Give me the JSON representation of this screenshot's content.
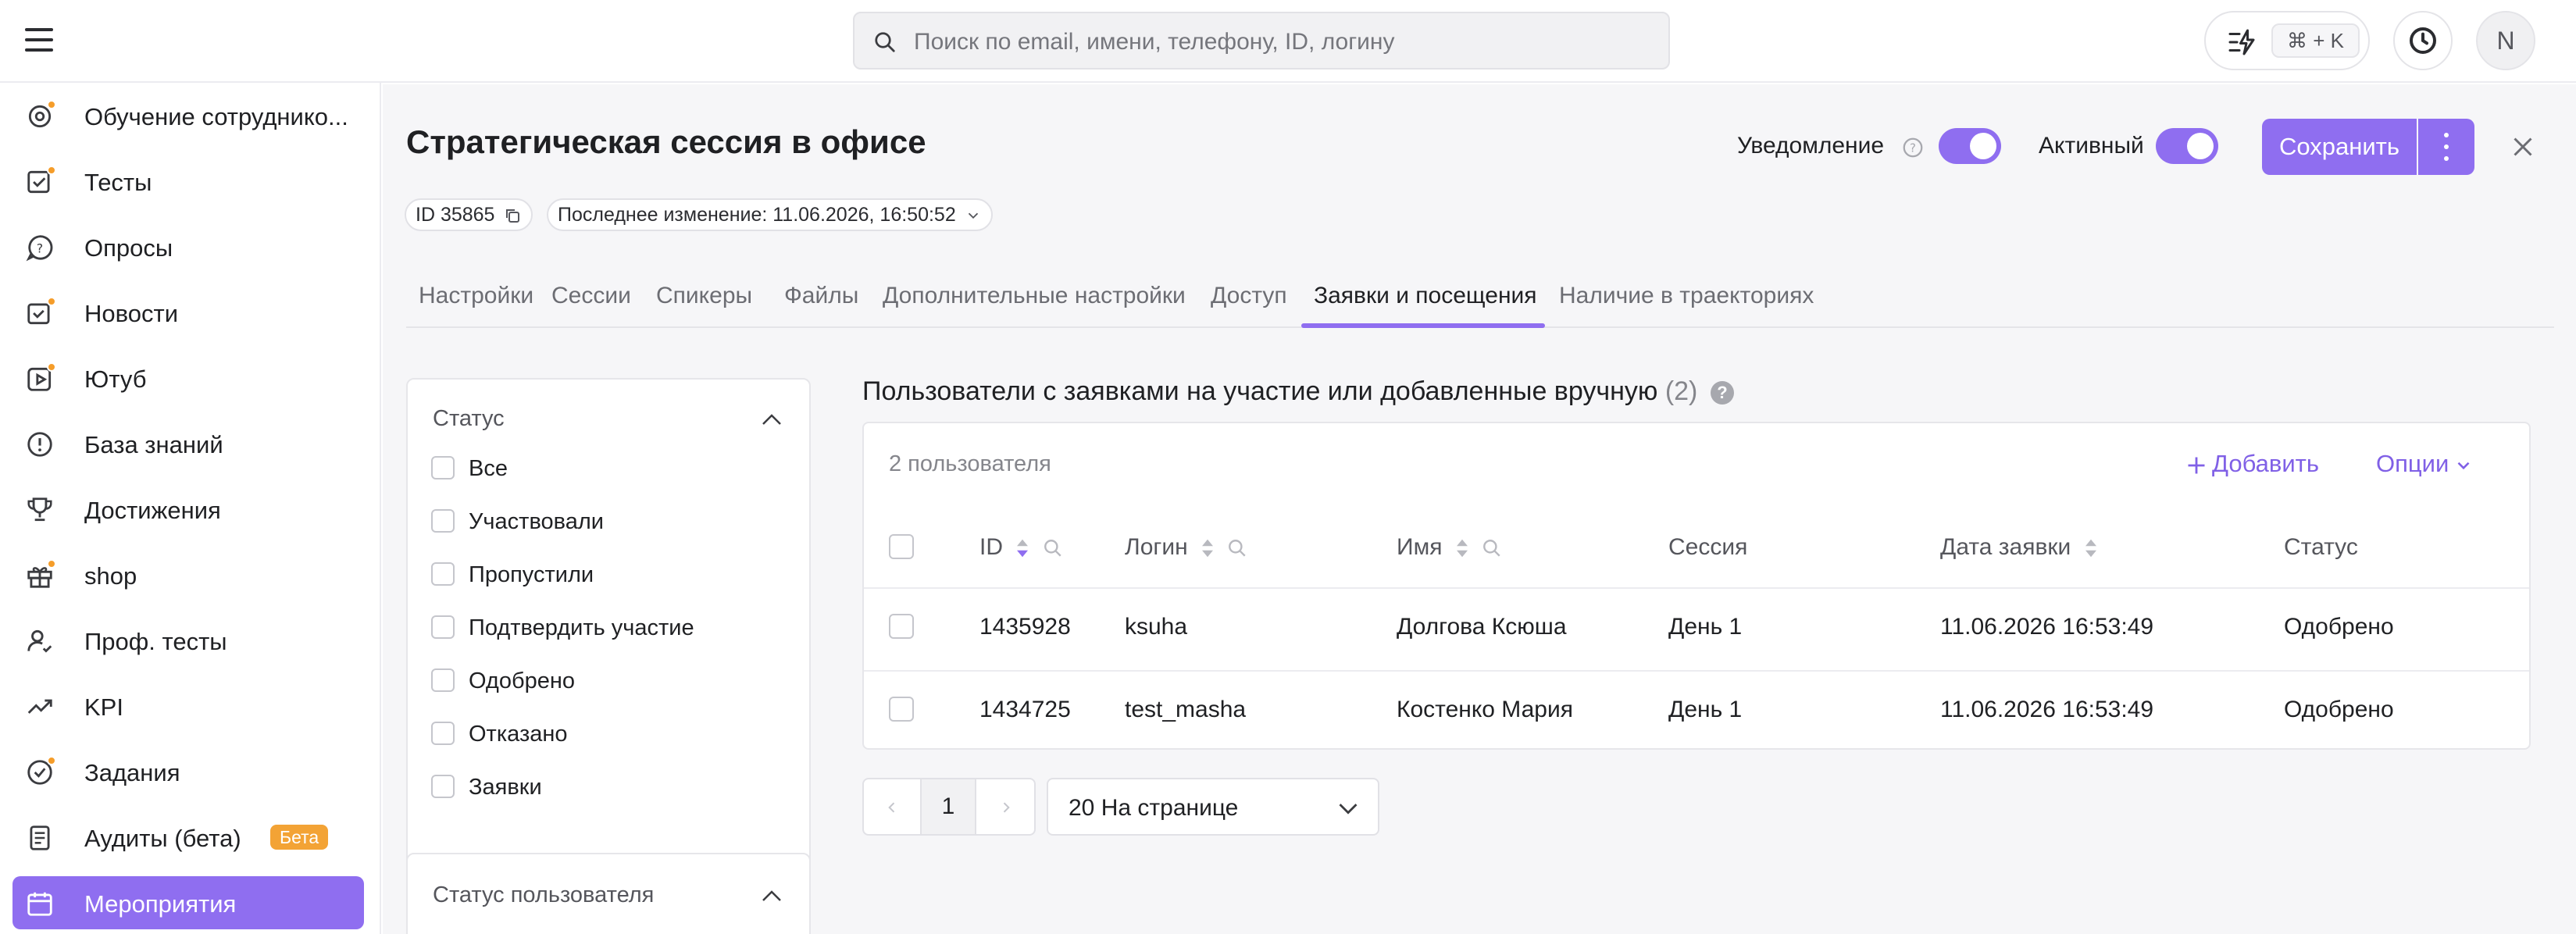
{
  "search": {
    "placeholder": "Поиск по email, имени, телефону, ID, логину"
  },
  "topbar": {
    "shortcut": "⌘ + K",
    "avatar_initial": "N"
  },
  "sidebar": {
    "items": [
      {
        "label": "Обучение сотруднико...",
        "icon": "graduation-icon"
      },
      {
        "label": "Тесты",
        "icon": "checklist-icon"
      },
      {
        "label": "Опросы",
        "icon": "chat-question-icon"
      },
      {
        "label": "Новости",
        "icon": "news-icon"
      },
      {
        "label": "Ютуб",
        "icon": "video-icon"
      },
      {
        "label": "База знаний",
        "icon": "knowledge-icon"
      },
      {
        "label": "Достижения",
        "icon": "trophy-icon"
      },
      {
        "label": "shop",
        "icon": "gift-icon"
      },
      {
        "label": "Проф. тесты",
        "icon": "user-test-icon"
      },
      {
        "label": "KPI",
        "icon": "trend-icon"
      },
      {
        "label": "Задания",
        "icon": "task-icon"
      },
      {
        "label": "Аудиты (бета)",
        "icon": "audit-icon",
        "badge": "Бета"
      },
      {
        "label": "Мероприятия",
        "icon": "calendar-icon",
        "active": true
      }
    ]
  },
  "header": {
    "title": "Стратегическая сессия в офисе",
    "id_chip": "ID 35865",
    "last_change": "Последнее изменение: 11.06.2026, 16:50:52",
    "notification_label": "Уведомление",
    "active_label": "Активный",
    "notification_on": true,
    "active_on": true,
    "save_label": "Сохранить"
  },
  "tabs": [
    {
      "label": "Настройки"
    },
    {
      "label": "Сессии"
    },
    {
      "label": "Спикеры"
    },
    {
      "label": "Файлы"
    },
    {
      "label": "Дополнительные настройки"
    },
    {
      "label": "Доступ"
    },
    {
      "label": "Заявки и посещения",
      "active": true
    },
    {
      "label": "Наличие в траекториях"
    }
  ],
  "filters": {
    "status": {
      "title": "Статус",
      "options": [
        "Все",
        "Участвовали",
        "Пропустили",
        "Подтвердить участие",
        "Одобрено",
        "Отказано",
        "Заявки"
      ]
    },
    "user_status": {
      "title": "Статус пользователя"
    }
  },
  "section": {
    "title": "Пользователи с заявками на участие или добавленные вручную",
    "count": "(2)"
  },
  "table": {
    "users_count": "2 пользователя",
    "add_label": "Добавить",
    "options_label": "Опции",
    "columns": [
      "ID",
      "Логин",
      "Имя",
      "Сессия",
      "Дата заявки",
      "Статус"
    ],
    "rows": [
      [
        "1435928",
        "ksuha",
        "Долгова Ксюша",
        "День 1",
        "11.06.2026 16:53:49",
        "Одобрено"
      ],
      [
        "1434725",
        "test_masha",
        "Костенко Мария",
        "День 1",
        "11.06.2026 16:53:49",
        "Одобрено"
      ]
    ]
  },
  "pagination": {
    "current_page": "1",
    "per_page": "20 На странице"
  },
  "colors": {
    "accent": "#8f6ef0",
    "badge": "#f3a335",
    "notification_dot": "#f59d2a"
  }
}
